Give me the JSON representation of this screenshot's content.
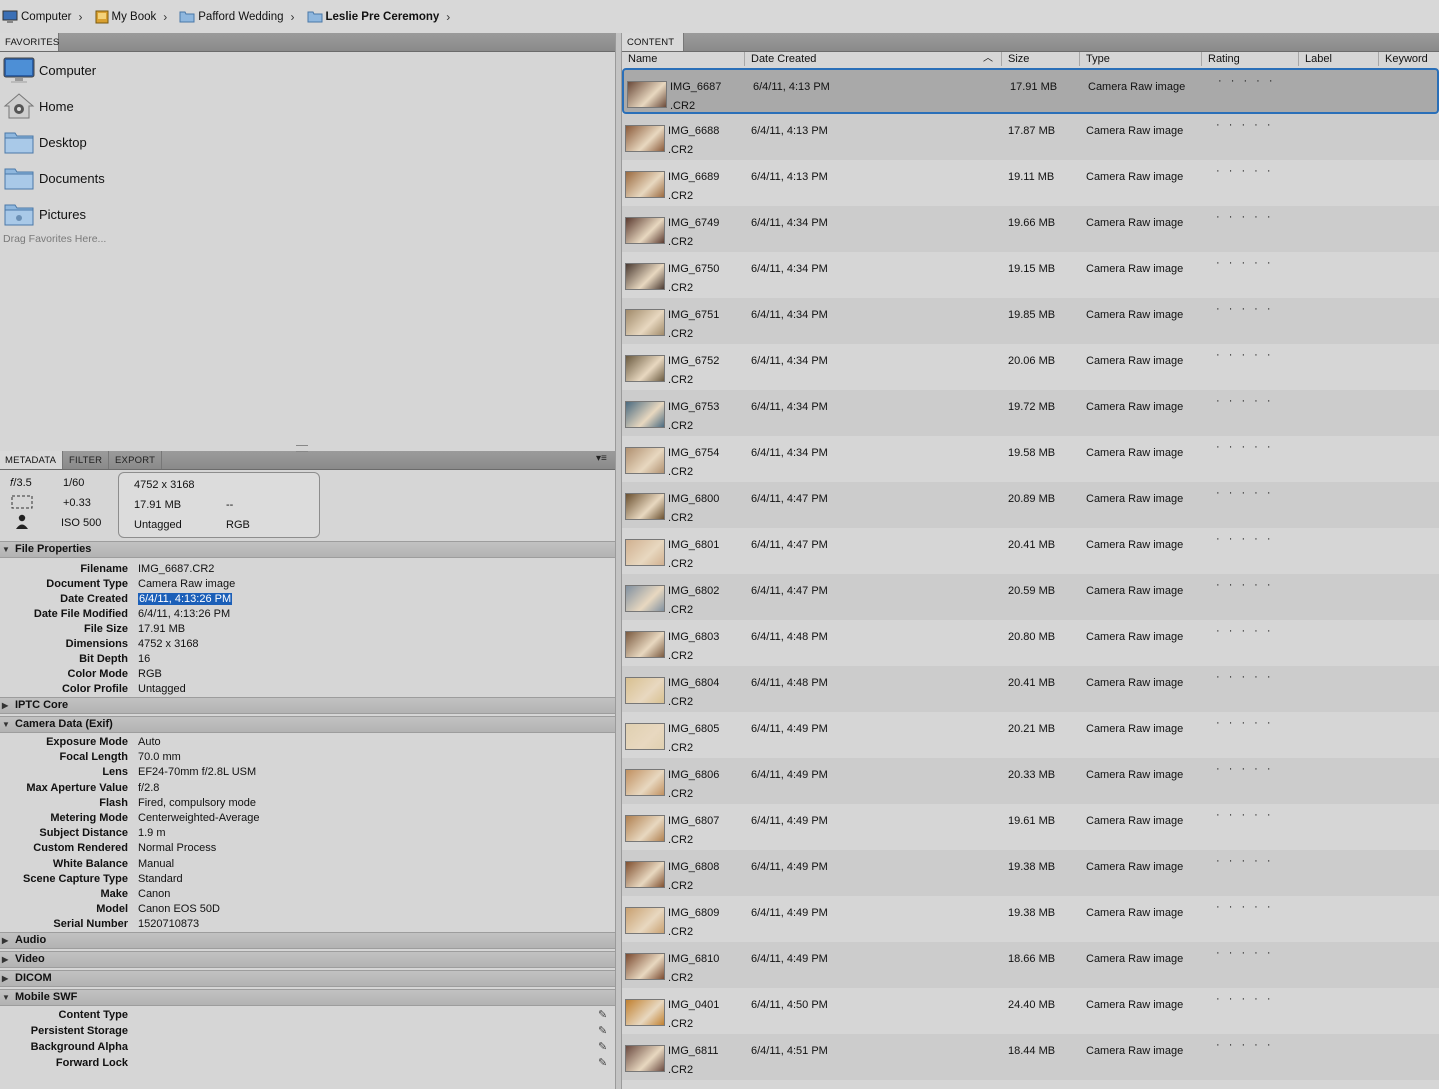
{
  "breadcrumb": [
    {
      "label": "Computer",
      "icon": "computer-icon"
    },
    {
      "label": "My Book",
      "icon": "drive-icon"
    },
    {
      "label": "Pafford Wedding",
      "icon": "folder-icon"
    },
    {
      "label": "Leslie Pre Ceremony",
      "icon": "folder-icon"
    }
  ],
  "tabs": {
    "favorites": "FAVORITES",
    "content": "CONTENT",
    "metadata": "METADATA",
    "filter": "FILTER",
    "export": "EXPORT"
  },
  "favorites": {
    "items": [
      {
        "label": "Computer",
        "icon": "computer-icon"
      },
      {
        "label": "Home",
        "icon": "home-icon"
      },
      {
        "label": "Desktop",
        "icon": "folder-icon"
      },
      {
        "label": "Documents",
        "icon": "folder-icon"
      },
      {
        "label": "Pictures",
        "icon": "folder-icon"
      }
    ],
    "hint": "Drag Favorites Here..."
  },
  "summary": {
    "aperture": "𝑓/3.5",
    "shutter": "1/60",
    "exposure": "+0.33",
    "iso": "ISO 500",
    "dimensions": "4752 x 3168",
    "size": "17.91 MB",
    "resolution": "--",
    "label": "Untagged",
    "colormode": "RGB"
  },
  "sections": {
    "file": "File Properties",
    "iptc": "IPTC Core",
    "camera": "Camera Data (Exif)",
    "audio": "Audio",
    "video": "Video",
    "dicom": "DICOM",
    "mobile": "Mobile SWF"
  },
  "file_props": [
    {
      "k": "Filename",
      "v": "IMG_6687.CR2"
    },
    {
      "k": "Document Type",
      "v": "Camera Raw image"
    },
    {
      "k": "Date Created",
      "v": "6/4/11, 4:13:26 PM"
    },
    {
      "k": "Date File Modified",
      "v": "6/4/11, 4:13:26 PM"
    },
    {
      "k": "File Size",
      "v": "17.91 MB"
    },
    {
      "k": "Dimensions",
      "v": "4752 x 3168"
    },
    {
      "k": "Bit Depth",
      "v": "16"
    },
    {
      "k": "Color Mode",
      "v": "RGB"
    },
    {
      "k": "Color Profile",
      "v": "Untagged"
    }
  ],
  "camera_props": [
    {
      "k": "Exposure Mode",
      "v": "Auto"
    },
    {
      "k": "Focal Length",
      "v": "70.0 mm"
    },
    {
      "k": "Lens",
      "v": "EF24-70mm f/2.8L USM"
    },
    {
      "k": "Max Aperture Value",
      "v": "f/2.8"
    },
    {
      "k": "Flash",
      "v": "Fired, compulsory mode"
    },
    {
      "k": "Metering Mode",
      "v": "Centerweighted-Average"
    },
    {
      "k": "Subject Distance",
      "v": "1.9 m"
    },
    {
      "k": "Custom Rendered",
      "v": "Normal Process"
    },
    {
      "k": "White Balance",
      "v": "Manual"
    },
    {
      "k": "Scene Capture Type",
      "v": "Standard"
    },
    {
      "k": "Make",
      "v": "Canon"
    },
    {
      "k": "Model",
      "v": "Canon EOS 50D"
    },
    {
      "k": "Serial Number",
      "v": "1520710873"
    }
  ],
  "mobile_props": [
    {
      "k": "Content Type"
    },
    {
      "k": "Persistent Storage"
    },
    {
      "k": "Background Alpha"
    },
    {
      "k": "Forward Lock"
    }
  ],
  "columns": {
    "name": "Name",
    "date": "Date Created",
    "size": "Size",
    "type": "Type",
    "rating": "Rating",
    "label": "Label",
    "keywords": "Keyword"
  },
  "files": [
    {
      "name": "IMG_6687",
      "ext": ".CR2",
      "date": "6/4/11, 4:13 PM",
      "size": "17.91 MB",
      "type": "Camera Raw image",
      "rating": "· · · · ·",
      "thumb": "#6a4a3a"
    },
    {
      "name": "IMG_6688",
      "ext": ".CR2",
      "date": "6/4/11, 4:13 PM",
      "size": "17.87 MB",
      "type": "Camera Raw image",
      "rating": "· · · · ·",
      "thumb": "#8a5a3a"
    },
    {
      "name": "IMG_6689",
      "ext": ".CR2",
      "date": "6/4/11, 4:13 PM",
      "size": "19.11 MB",
      "type": "Camera Raw image",
      "rating": "· · · · ·",
      "thumb": "#9a6a40"
    },
    {
      "name": "IMG_6749",
      "ext": ".CR2",
      "date": "6/4/11, 4:34 PM",
      "size": "19.66 MB",
      "type": "Camera Raw image",
      "rating": "· · · · ·",
      "thumb": "#5a3a30"
    },
    {
      "name": "IMG_6750",
      "ext": ".CR2",
      "date": "6/4/11, 4:34 PM",
      "size": "19.15 MB",
      "type": "Camera Raw image",
      "rating": "· · · · ·",
      "thumb": "#4a3a32"
    },
    {
      "name": "IMG_6751",
      "ext": ".CR2",
      "date": "6/4/11, 4:34 PM",
      "size": "19.85 MB",
      "type": "Camera Raw image",
      "rating": "· · · · ·",
      "thumb": "#a08a6a"
    },
    {
      "name": "IMG_6752",
      "ext": ".CR2",
      "date": "6/4/11, 4:34 PM",
      "size": "20.06 MB",
      "type": "Camera Raw image",
      "rating": "· · · · ·",
      "thumb": "#6a5a40"
    },
    {
      "name": "IMG_6753",
      "ext": ".CR2",
      "date": "6/4/11, 4:34 PM",
      "size": "19.72 MB",
      "type": "Camera Raw image",
      "rating": "· · · · ·",
      "thumb": "#4a6a80"
    },
    {
      "name": "IMG_6754",
      "ext": ".CR2",
      "date": "6/4/11, 4:34 PM",
      "size": "19.58 MB",
      "type": "Camera Raw image",
      "rating": "· · · · ·",
      "thumb": "#b09070"
    },
    {
      "name": "IMG_6800",
      "ext": ".CR2",
      "date": "6/4/11, 4:47 PM",
      "size": "20.89 MB",
      "type": "Camera Raw image",
      "rating": "· · · · ·",
      "thumb": "#6a5030"
    },
    {
      "name": "IMG_6801",
      "ext": ".CR2",
      "date": "6/4/11, 4:47 PM",
      "size": "20.41 MB",
      "type": "Camera Raw image",
      "rating": "· · · · ·",
      "thumb": "#d0b090"
    },
    {
      "name": "IMG_6802",
      "ext": ".CR2",
      "date": "6/4/11, 4:47 PM",
      "size": "20.59 MB",
      "type": "Camera Raw image",
      "rating": "· · · · ·",
      "thumb": "#8090a0"
    },
    {
      "name": "IMG_6803",
      "ext": ".CR2",
      "date": "6/4/11, 4:48 PM",
      "size": "20.80 MB",
      "type": "Camera Raw image",
      "rating": "· · · · ·",
      "thumb": "#7a5a40"
    },
    {
      "name": "IMG_6804",
      "ext": ".CR2",
      "date": "6/4/11, 4:48 PM",
      "size": "20.41 MB",
      "type": "Camera Raw image",
      "rating": "· · · · ·",
      "thumb": "#d8c090"
    },
    {
      "name": "IMG_6805",
      "ext": ".CR2",
      "date": "6/4/11, 4:49 PM",
      "size": "20.21 MB",
      "type": "Camera Raw image",
      "rating": "· · · · ·",
      "thumb": "#e0d0b0"
    },
    {
      "name": "IMG_6806",
      "ext": ".CR2",
      "date": "6/4/11, 4:49 PM",
      "size": "20.33 MB",
      "type": "Camera Raw image",
      "rating": "· · · · ·",
      "thumb": "#c09060"
    },
    {
      "name": "IMG_6807",
      "ext": ".CR2",
      "date": "6/4/11, 4:49 PM",
      "size": "19.61 MB",
      "type": "Camera Raw image",
      "rating": "· · · · ·",
      "thumb": "#b08050"
    },
    {
      "name": "IMG_6808",
      "ext": ".CR2",
      "date": "6/4/11, 4:49 PM",
      "size": "19.38 MB",
      "type": "Camera Raw image",
      "rating": "· · · · ·",
      "thumb": "#805030"
    },
    {
      "name": "IMG_6809",
      "ext": ".CR2",
      "date": "6/4/11, 4:49 PM",
      "size": "19.38 MB",
      "type": "Camera Raw image",
      "rating": "· · · · ·",
      "thumb": "#c8a070"
    },
    {
      "name": "IMG_6810",
      "ext": ".CR2",
      "date": "6/4/11, 4:49 PM",
      "size": "18.66 MB",
      "type": "Camera Raw image",
      "rating": "· · · · ·",
      "thumb": "#7a4a30"
    },
    {
      "name": "IMG_0401",
      "ext": ".CR2",
      "date": "6/4/11, 4:50 PM",
      "size": "24.40 MB",
      "type": "Camera Raw image",
      "rating": "· · · · ·",
      "thumb": "#c08030"
    },
    {
      "name": "IMG_6811",
      "ext": ".CR2",
      "date": "6/4/11, 4:51 PM",
      "size": "18.44 MB",
      "type": "Camera Raw image",
      "rating": "· · · · ·",
      "thumb": "#6a4a40"
    }
  ]
}
